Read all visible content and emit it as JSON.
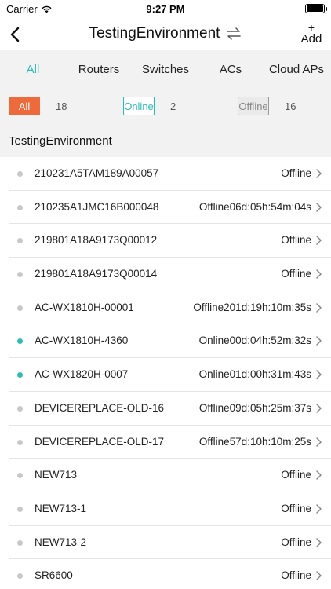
{
  "status_bar": {
    "carrier": "Carrier",
    "time": "9:27 PM",
    "wifi_icon": "wifi-icon",
    "battery_icon": "battery-icon"
  },
  "nav": {
    "title": "TestingEnvironment",
    "back_icon": "chevron-left-icon",
    "switch_icon": "swap-arrows-icon",
    "add_plus": "+",
    "add_label": "Add"
  },
  "tabs": [
    {
      "label": "All",
      "active": true
    },
    {
      "label": "Routers",
      "active": false
    },
    {
      "label": "Switches",
      "active": false
    },
    {
      "label": "ACs",
      "active": false
    },
    {
      "label": "Cloud APs",
      "active": false
    }
  ],
  "filters": {
    "all": {
      "label": "All",
      "count": "18"
    },
    "online": {
      "label": "Online",
      "count": "2"
    },
    "offline": {
      "label": "Offline",
      "count": "16"
    }
  },
  "section_title": "TestingEnvironment",
  "devices": [
    {
      "name": "210231A5TAM189A00057",
      "status": "Offline",
      "online": false
    },
    {
      "name": "210235A1JMC16B000048",
      "status": "Offline06d:05h:54m:04s",
      "online": false
    },
    {
      "name": "219801A18A9173Q00012",
      "status": "Offline",
      "online": false
    },
    {
      "name": "219801A18A9173Q00014",
      "status": "Offline",
      "online": false
    },
    {
      "name": "AC-WX1810H-00001",
      "status": "Offline201d:19h:10m:35s",
      "online": false
    },
    {
      "name": "AC-WX1810H-4360",
      "status": "Online00d:04h:52m:32s",
      "online": true
    },
    {
      "name": "AC-WX1820H-0007",
      "status": "Online01d:00h:31m:43s",
      "online": true
    },
    {
      "name": "DEVICEREPLACE-OLD-16",
      "status": "Offline09d:05h:25m:37s",
      "online": false
    },
    {
      "name": "DEVICEREPLACE-OLD-17",
      "status": "Offline57d:10h:10m:25s",
      "online": false
    },
    {
      "name": "NEW713",
      "status": "Offline",
      "online": false
    },
    {
      "name": "NEW713-1",
      "status": "Offline",
      "online": false
    },
    {
      "name": "NEW713-2",
      "status": "Offline",
      "online": false
    },
    {
      "name": "SR6600",
      "status": "Offline",
      "online": false
    }
  ],
  "colors": {
    "accent": "#2bbcb4",
    "all_chip": "#ef6a3a",
    "offline_dot": "#c8c8c8",
    "background_gray": "#f2f2f2"
  }
}
